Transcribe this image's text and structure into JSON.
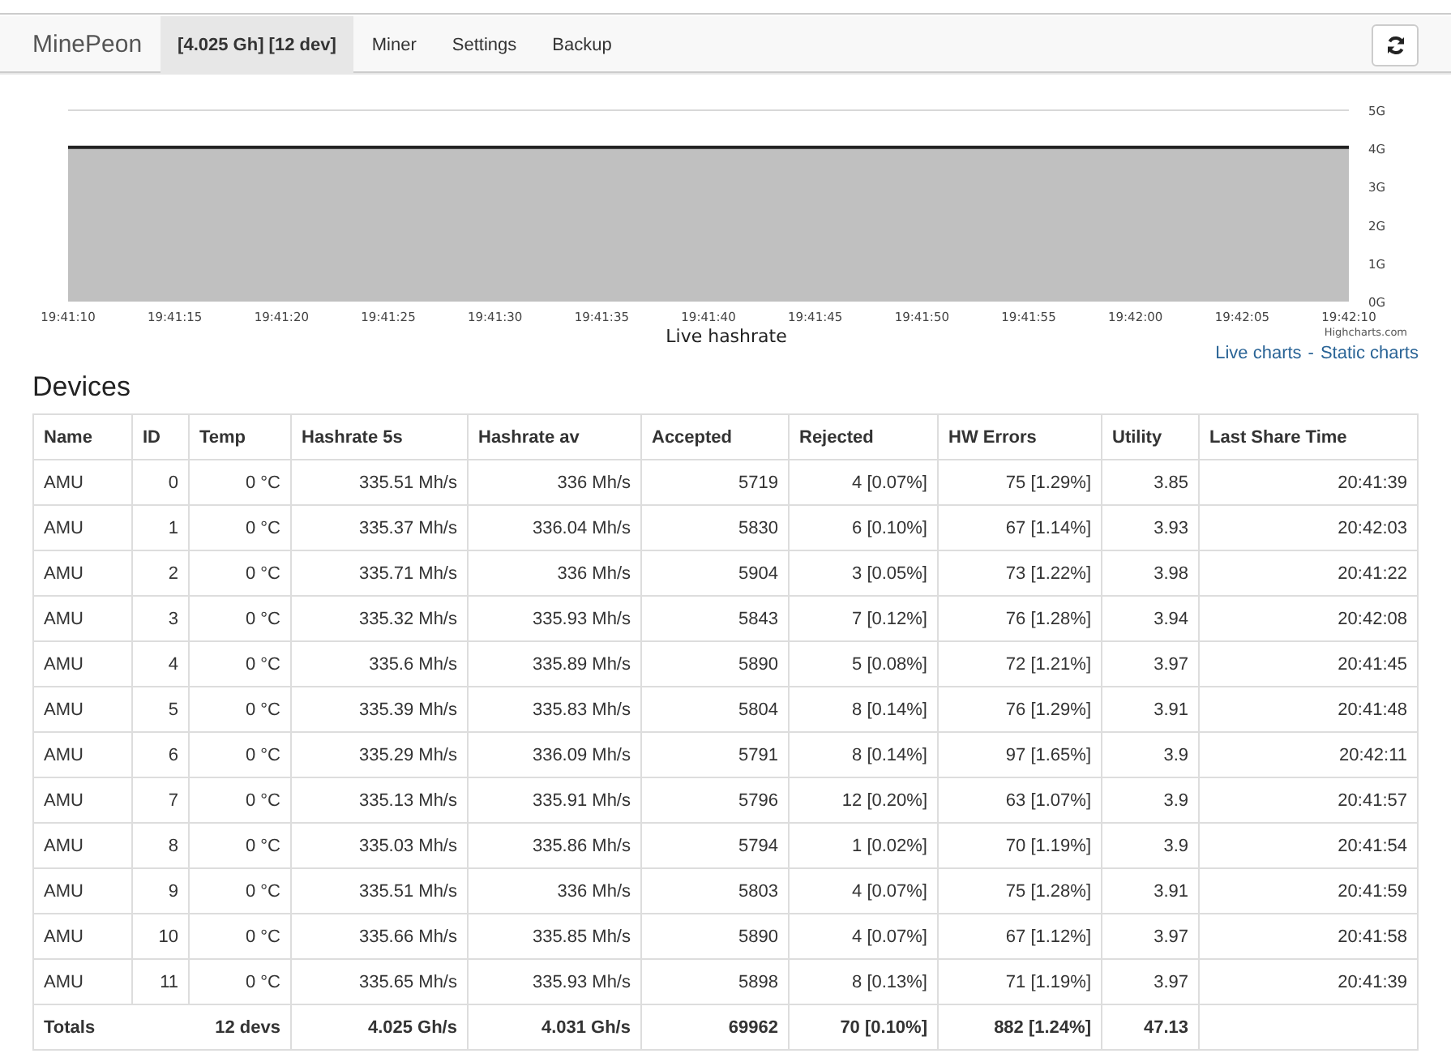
{
  "navbar": {
    "brand": "MinePeon",
    "items": [
      {
        "label": "[4.025 Gh] [12 dev]",
        "selected": true
      },
      {
        "label": "Miner",
        "selected": false
      },
      {
        "label": "Settings",
        "selected": false
      },
      {
        "label": "Backup",
        "selected": false
      }
    ]
  },
  "chart": {
    "chart_data": {
      "type": "area",
      "title": "Live hashrate",
      "categories": [
        "19:41:10",
        "19:41:15",
        "19:41:20",
        "19:41:25",
        "19:41:30",
        "19:41:35",
        "19:41:40",
        "19:41:45",
        "19:41:50",
        "19:41:55",
        "19:42:00",
        "19:42:05",
        "19:42:10"
      ],
      "series": [
        {
          "color": "#222222",
          "values": [
            4.03,
            4.03,
            4.03,
            4.03,
            4.03,
            4.03,
            4.03,
            4.03,
            4.03,
            4.03,
            4.03,
            4.03,
            4.03
          ]
        }
      ],
      "ylim": [
        0,
        5
      ],
      "yticks": [
        {
          "value": 0,
          "label": "0G"
        },
        {
          "value": 1,
          "label": "1G"
        },
        {
          "value": 2,
          "label": "2G"
        },
        {
          "value": 3,
          "label": "3G"
        },
        {
          "value": 4,
          "label": "4G"
        },
        {
          "value": 5,
          "label": "5G"
        }
      ]
    },
    "credit": "Highcharts.com"
  },
  "chart_links": [
    {
      "label": "Live charts"
    },
    {
      "label": "Static charts"
    }
  ],
  "chart_links_separator": "-",
  "devices": {
    "heading": "Devices",
    "columns": [
      "Name",
      "ID",
      "Temp",
      "Hashrate 5s",
      "Hashrate av",
      "Accepted",
      "Rejected",
      "HW Errors",
      "Utility",
      "Last Share Time"
    ],
    "rows": [
      [
        "AMU",
        "0",
        "0 °C",
        "335.51 Mh/s",
        "336 Mh/s",
        "5719",
        "4 [0.07%]",
        "75 [1.29%]",
        "3.85",
        "20:41:39"
      ],
      [
        "AMU",
        "1",
        "0 °C",
        "335.37 Mh/s",
        "336.04 Mh/s",
        "5830",
        "6 [0.10%]",
        "67 [1.14%]",
        "3.93",
        "20:42:03"
      ],
      [
        "AMU",
        "2",
        "0 °C",
        "335.71 Mh/s",
        "336 Mh/s",
        "5904",
        "3 [0.05%]",
        "73 [1.22%]",
        "3.98",
        "20:41:22"
      ],
      [
        "AMU",
        "3",
        "0 °C",
        "335.32 Mh/s",
        "335.93 Mh/s",
        "5843",
        "7 [0.12%]",
        "76 [1.28%]",
        "3.94",
        "20:42:08"
      ],
      [
        "AMU",
        "4",
        "0 °C",
        "335.6 Mh/s",
        "335.89 Mh/s",
        "5890",
        "5 [0.08%]",
        "72 [1.21%]",
        "3.97",
        "20:41:45"
      ],
      [
        "AMU",
        "5",
        "0 °C",
        "335.39 Mh/s",
        "335.83 Mh/s",
        "5804",
        "8 [0.14%]",
        "76 [1.29%]",
        "3.91",
        "20:41:48"
      ],
      [
        "AMU",
        "6",
        "0 °C",
        "335.29 Mh/s",
        "336.09 Mh/s",
        "5791",
        "8 [0.14%]",
        "97 [1.65%]",
        "3.9",
        "20:42:11"
      ],
      [
        "AMU",
        "7",
        "0 °C",
        "335.13 Mh/s",
        "335.91 Mh/s",
        "5796",
        "12 [0.20%]",
        "63 [1.07%]",
        "3.9",
        "20:41:57"
      ],
      [
        "AMU",
        "8",
        "0 °C",
        "335.03 Mh/s",
        "335.86 Mh/s",
        "5794",
        "1 [0.02%]",
        "70 [1.19%]",
        "3.9",
        "20:41:54"
      ],
      [
        "AMU",
        "9",
        "0 °C",
        "335.51 Mh/s",
        "336 Mh/s",
        "5803",
        "4 [0.07%]",
        "75 [1.28%]",
        "3.91",
        "20:41:59"
      ],
      [
        "AMU",
        "10",
        "0 °C",
        "335.66 Mh/s",
        "335.85 Mh/s",
        "5890",
        "4 [0.07%]",
        "67 [1.12%]",
        "3.97",
        "20:41:58"
      ],
      [
        "AMU",
        "11",
        "0 °C",
        "335.65 Mh/s",
        "335.93 Mh/s",
        "5898",
        "8 [0.13%]",
        "71 [1.19%]",
        "3.97",
        "20:41:39"
      ]
    ],
    "totals": {
      "label": "Totals",
      "devices": "12 devs",
      "hashrate_5s": "4.025 Gh/s",
      "hashrate_av": "4.031 Gh/s",
      "accepted": "69962",
      "rejected": "70 [0.10%]",
      "hw_errors": "882 [1.24%]",
      "utility": "47.13"
    }
  }
}
